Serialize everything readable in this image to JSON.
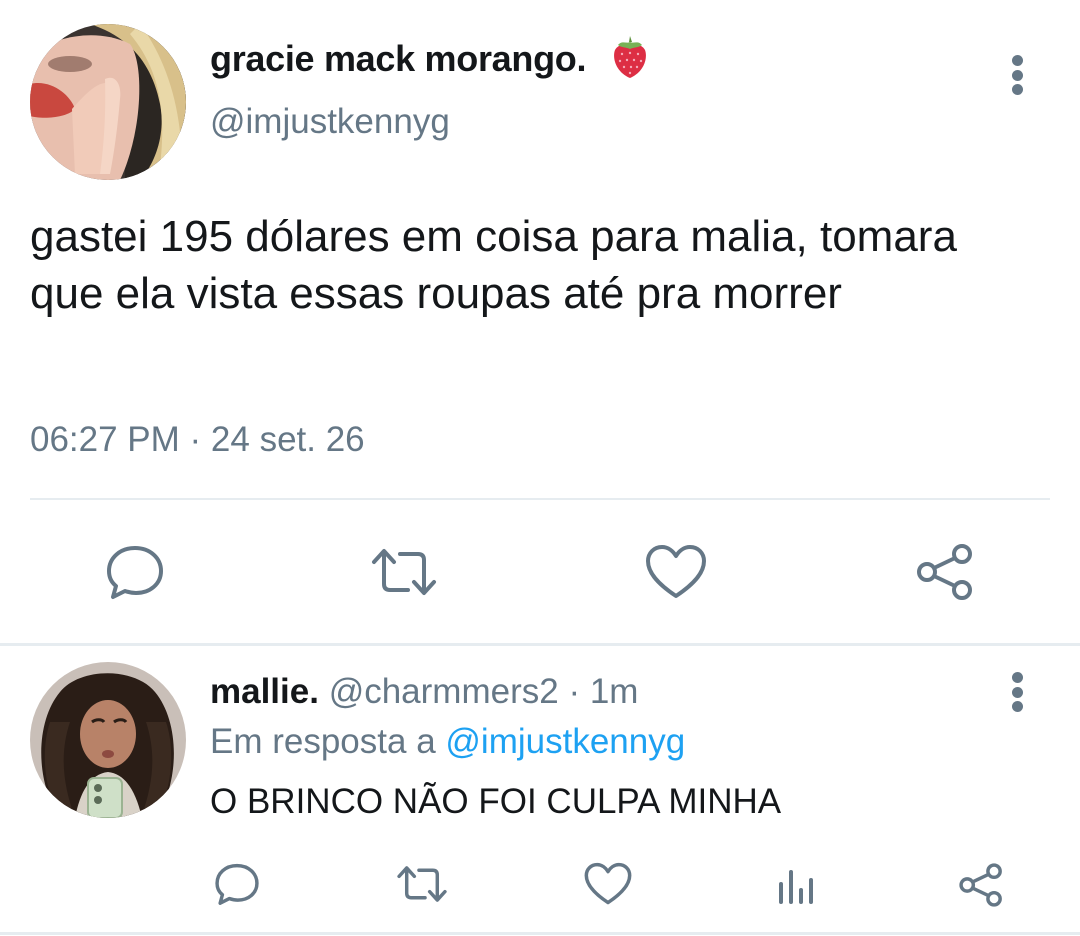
{
  "main_tweet": {
    "author_name": "gracie mack morango.",
    "author_emoji_icon": "strawberry-emoji",
    "handle": "@imjustkennyg",
    "text": "gastei 195 dólares em coisa para malia, tomara que ela vista essas roupas até pra morrer",
    "timestamp": "06:27 PM · 24 set. 26",
    "actions": [
      "reply-icon",
      "retweet-icon",
      "like-icon",
      "share-icon"
    ]
  },
  "reply_tweet": {
    "author_name": "mallie.",
    "handle": "@charmmers2",
    "time_ago": "· 1m",
    "reply_to_prefix": "Em resposta a",
    "reply_to_handle": "@imjustkennyg",
    "text": "O BRINCO NÃO FOI CULPA MINHA",
    "actions": [
      "reply-icon",
      "retweet-icon",
      "like-icon",
      "stats-icon",
      "share-icon"
    ]
  },
  "colors": {
    "text_primary": "#14171a",
    "text_secondary": "#657786",
    "link": "#1da1f2",
    "divider": "#e6ecf0"
  }
}
